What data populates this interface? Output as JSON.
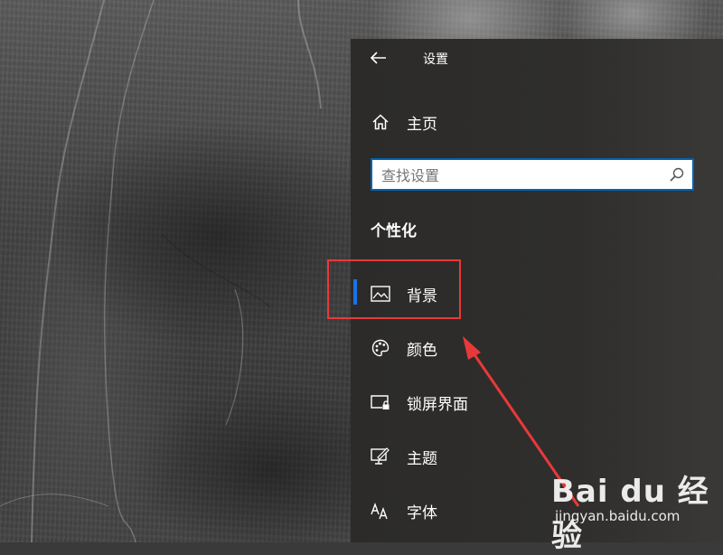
{
  "window": {
    "title": "设置",
    "back_icon": "back-arrow-icon"
  },
  "nav": {
    "home_label": "主页",
    "home_icon": "home-icon"
  },
  "search": {
    "placeholder": "查找设置",
    "icon": "search-icon"
  },
  "section": {
    "title": "个性化"
  },
  "menu": {
    "items": [
      {
        "label": "背景",
        "icon": "picture-icon",
        "selected": true
      },
      {
        "label": "颜色",
        "icon": "palette-icon"
      },
      {
        "label": "锁屏界面",
        "icon": "lock-screen-icon"
      },
      {
        "label": "主题",
        "icon": "theme-icon"
      },
      {
        "label": "字体",
        "icon": "font-icon"
      }
    ]
  },
  "colors": {
    "accent": "#1a73e8",
    "annotation": "#e8393a",
    "panel_bg": "#2f2e2c"
  },
  "watermark": {
    "logo": "Bai du 经验",
    "site": "jingyan.baidu.com"
  }
}
